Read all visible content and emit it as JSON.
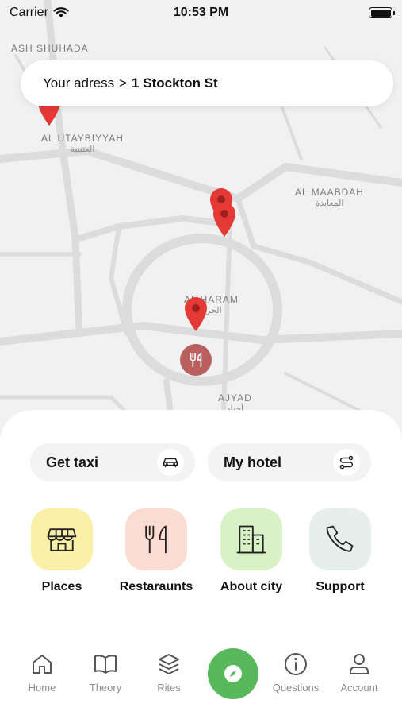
{
  "status_bar": {
    "carrier": "Carrier",
    "time": "10:53 PM"
  },
  "address_bar": {
    "prefix": "Your adress",
    "separator": ">",
    "street": "1 Stockton St"
  },
  "map": {
    "labels": [
      {
        "en": "ASH SHUHADA",
        "ar": ""
      },
      {
        "en": "AL UTAYBIYYAH",
        "ar": "العتيبية"
      },
      {
        "en": "AL MAABDAH",
        "ar": "المعابدة"
      },
      {
        "en": "AL HARAM",
        "ar": "الحرم"
      },
      {
        "en": "AJYAD",
        "ar": "أجياد"
      }
    ],
    "marker_color": "#e53935",
    "food_marker_color": "#b9605e"
  },
  "quick_actions": [
    {
      "label": "Get taxi",
      "icon": "car-icon"
    },
    {
      "label": "My hotel",
      "icon": "route-icon"
    }
  ],
  "categories": [
    {
      "label": "Places",
      "icon": "store-icon",
      "color": "#fbf0a8"
    },
    {
      "label": "Restaraunts",
      "icon": "fork-knife-icon",
      "color": "#fbdcd2"
    },
    {
      "label": "About city",
      "icon": "buildings-icon",
      "color": "#d8f2c6"
    },
    {
      "label": "Support",
      "icon": "phone-icon",
      "color": "#e6efec"
    }
  ],
  "tab_bar": {
    "items": [
      {
        "label": "Home",
        "icon": "home-icon"
      },
      {
        "label": "Theory",
        "icon": "book-icon"
      },
      {
        "label": "Rites",
        "icon": "layers-icon"
      },
      {
        "label": "",
        "icon": "compass-icon"
      },
      {
        "label": "Questions",
        "icon": "info-icon"
      },
      {
        "label": "Account",
        "icon": "user-icon"
      }
    ],
    "accent": "#57b85c"
  }
}
